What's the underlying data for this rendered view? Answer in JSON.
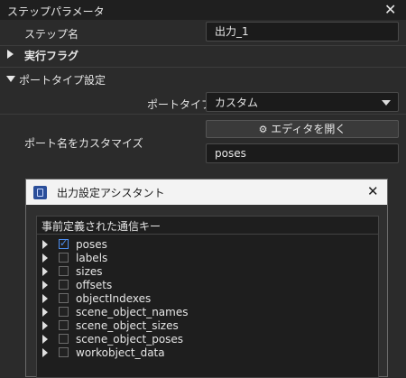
{
  "panel": {
    "title": "ステップパラメータ",
    "close": "✕"
  },
  "step_name": {
    "label": "ステップ名",
    "value": "出力_1"
  },
  "exec_flag": {
    "label": "実行フラグ"
  },
  "port_type_settings": {
    "label": "ポートタイプ設定",
    "port_type": {
      "label": "ポートタイプ",
      "value": "カスタム"
    },
    "customize": {
      "label": "ポート名をカスタマイズ",
      "button": "エディタを開く",
      "value": "poses"
    }
  },
  "dialog": {
    "title": "出力設定アシスタント",
    "close": "✕",
    "tree_header": "事前定義された通信キー",
    "items": [
      {
        "label": "poses",
        "checked": true
      },
      {
        "label": "labels",
        "checked": false
      },
      {
        "label": "sizes",
        "checked": false
      },
      {
        "label": "offsets",
        "checked": false
      },
      {
        "label": "objectIndexes",
        "checked": false
      },
      {
        "label": "scene_object_names",
        "checked": false
      },
      {
        "label": "scene_object_sizes",
        "checked": false
      },
      {
        "label": "scene_object_poses",
        "checked": false
      },
      {
        "label": "workobject_data",
        "checked": false
      }
    ]
  }
}
